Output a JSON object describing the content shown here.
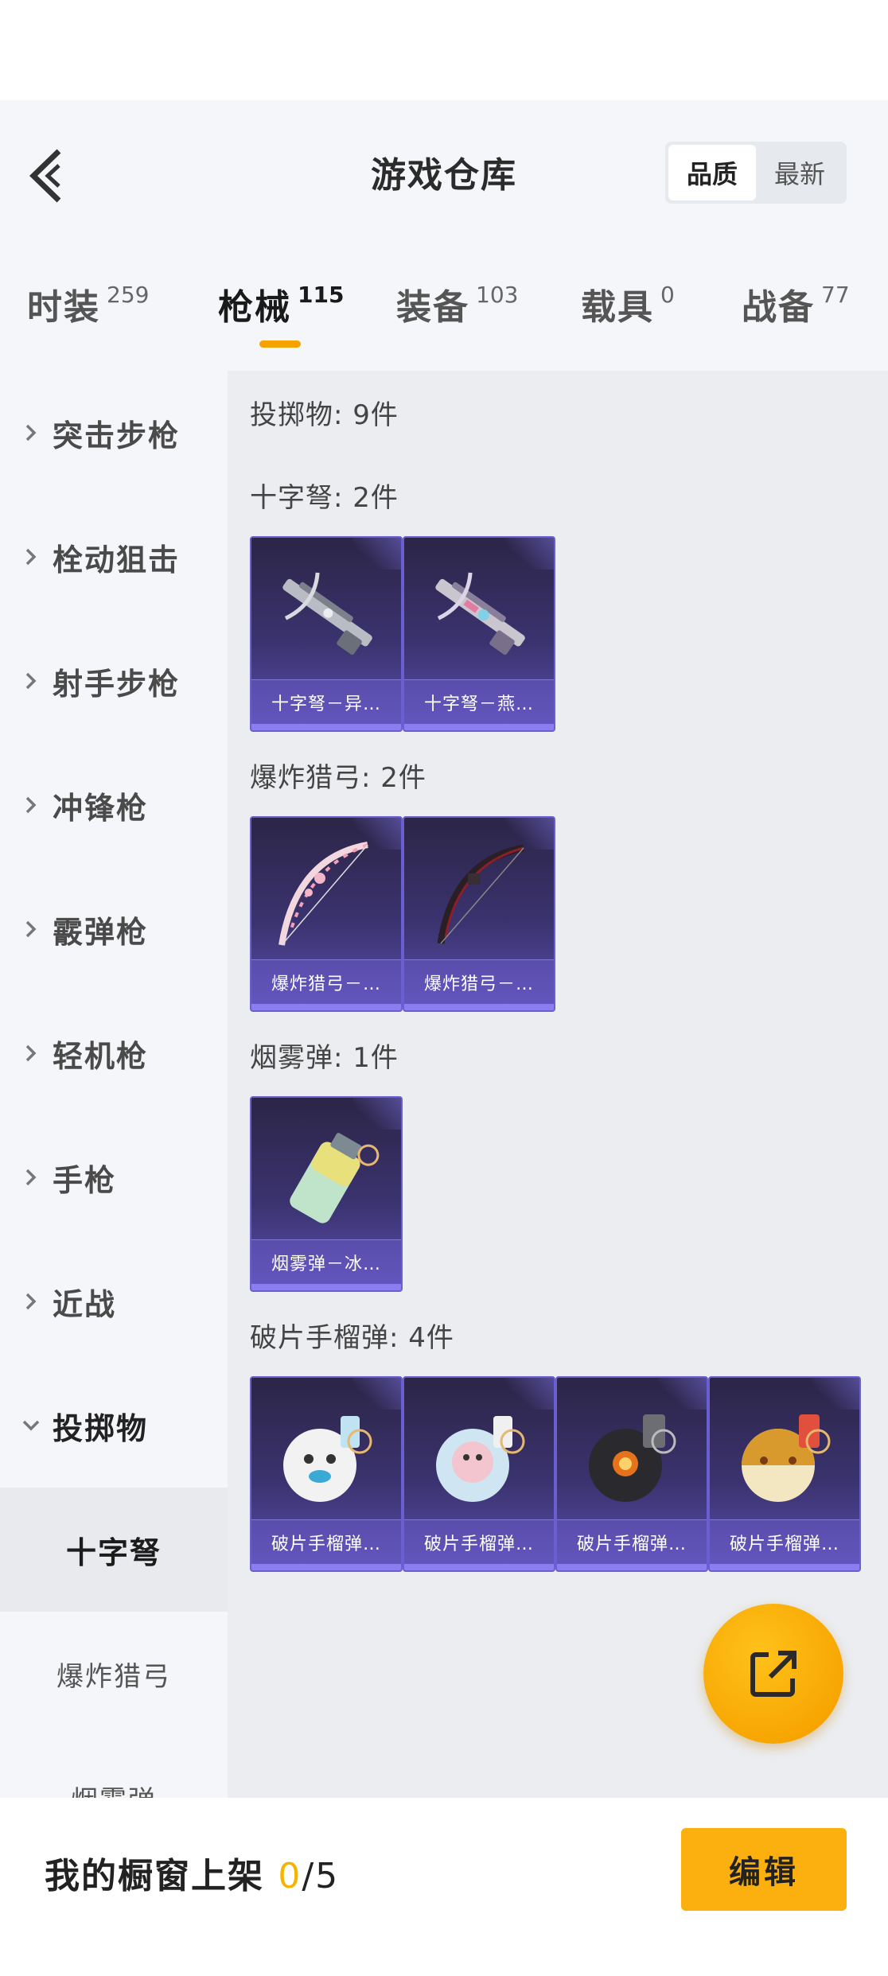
{
  "header": {
    "title": "游戏仓库",
    "sort_options": [
      "品质",
      "最新"
    ],
    "sort_selected": "品质"
  },
  "tabs": [
    {
      "label": "时装",
      "count": "259"
    },
    {
      "label": "枪械",
      "count": "115"
    },
    {
      "label": "装备",
      "count": "103"
    },
    {
      "label": "载具",
      "count": "0"
    },
    {
      "label": "战备",
      "count": "77"
    }
  ],
  "active_tab": "枪械",
  "sidebar": {
    "categories": [
      "突击步枪",
      "栓动狙击",
      "射手步枪",
      "冲锋枪",
      "霰弹枪",
      "轻机枪",
      "手枪",
      "近战",
      "投掷物"
    ],
    "open_category": "投掷物",
    "subcategories": [
      "十字弩",
      "爆炸猎弓",
      "烟雾弹"
    ],
    "active_subcategory": "十字弩"
  },
  "content": {
    "header_section": "投掷物: 9件",
    "sections": [
      {
        "title": "十字弩: 2件",
        "items": [
          "十字弩－异…",
          "十字弩－燕…"
        ]
      },
      {
        "title": "爆炸猎弓: 2件",
        "items": [
          "爆炸猎弓－…",
          "爆炸猎弓－…"
        ]
      },
      {
        "title": "烟雾弹: 1件",
        "items": [
          "烟雾弹－冰…"
        ]
      },
      {
        "title": "破片手榴弹: 4件",
        "items": [
          "破片手榴弹…",
          "破片手榴弹…",
          "破片手榴弹…",
          "破片手榴弹…"
        ]
      }
    ]
  },
  "bottom": {
    "showcase_label": "我的橱窗上架 ",
    "showcase_count": "0",
    "showcase_total": "/5",
    "edit_label": "编辑"
  },
  "icons": {
    "back": "back-arrow-icon",
    "chevron": "chevron-right-icon",
    "fab": "share-external-icon"
  },
  "colors": {
    "accent": "#f5a300",
    "card_purple": "#3b3370"
  }
}
